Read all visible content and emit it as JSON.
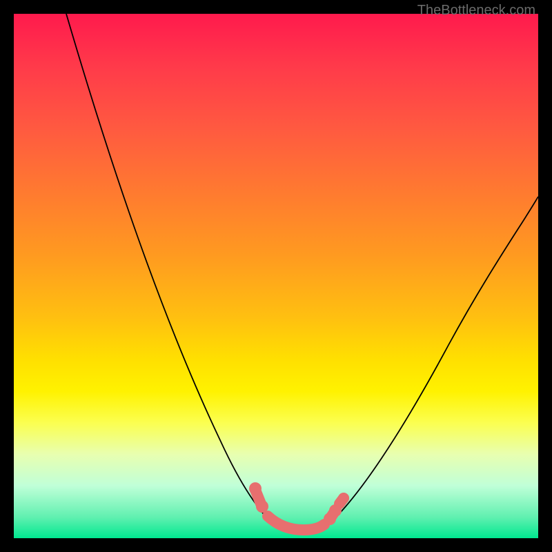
{
  "watermark": "TheBottleneck.com",
  "colors": {
    "frame_bg_top": "#ff1a4d",
    "frame_bg_bottom": "#00e890",
    "curve_stroke": "#000000",
    "worm_stroke": "#e76f6f",
    "page_bg": "#000000"
  },
  "chart_data": {
    "type": "line",
    "title": "",
    "xlabel": "",
    "ylabel": "",
    "xlim": [
      0,
      100
    ],
    "ylim": [
      0,
      100
    ],
    "grid": false,
    "legend": false,
    "series": [
      {
        "name": "left-curve",
        "x": [
          10,
          15,
          20,
          25,
          30,
          35,
          40,
          45,
          48,
          50
        ],
        "y": [
          100,
          85,
          70,
          56,
          43,
          31,
          21,
          12,
          6,
          2
        ]
      },
      {
        "name": "right-curve",
        "x": [
          60,
          63,
          66,
          70,
          75,
          80,
          85,
          90,
          95,
          100
        ],
        "y": [
          3,
          6,
          10,
          16,
          24,
          33,
          42,
          50,
          58,
          65
        ]
      },
      {
        "name": "valley-highlight",
        "x": [
          46,
          50,
          54,
          58,
          60,
          62
        ],
        "y": [
          8,
          2,
          1.5,
          1.5,
          3,
          5
        ]
      }
    ],
    "annotation_beads": [
      {
        "x": 46,
        "y": 9
      },
      {
        "x": 60,
        "y": 3
      },
      {
        "x": 62,
        "y": 6
      }
    ]
  }
}
